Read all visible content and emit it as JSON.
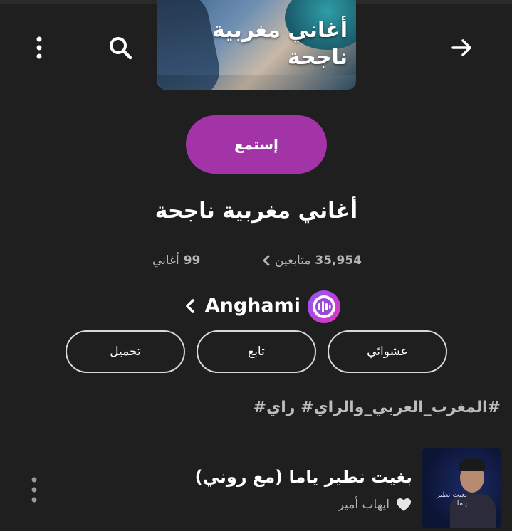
{
  "header": {
    "back_icon": "arrow-right-icon",
    "search_icon": "search-icon",
    "more_icon": "more-vertical-icon"
  },
  "cover": {
    "title": "أغاني مغربية ناجحة"
  },
  "actions": {
    "listen_label": "إستمع"
  },
  "playlist": {
    "title": "أغاني مغربية ناجحة",
    "followers_count": "35,954",
    "followers_label": "متابعين",
    "songs_count": "99",
    "songs_label": "أغاني",
    "owner_name": "Anghami"
  },
  "pills": {
    "shuffle": "عشوائي",
    "follow": "تابع",
    "download": "تحميل"
  },
  "hashtags": "#المغرب_العربي_والراي# راي#",
  "track": {
    "title": "بغيت نطير ياما (مع روني)",
    "artist": "ايهاب أمير",
    "art_text": "بغيت نطير ياما"
  },
  "colors": {
    "background": "#1f1f1f",
    "accent": "#a334a8",
    "muted_text": "#b5b5b5",
    "brand_gradient_start": "#8d5cf6",
    "brand_gradient_end": "#e23cbd"
  }
}
